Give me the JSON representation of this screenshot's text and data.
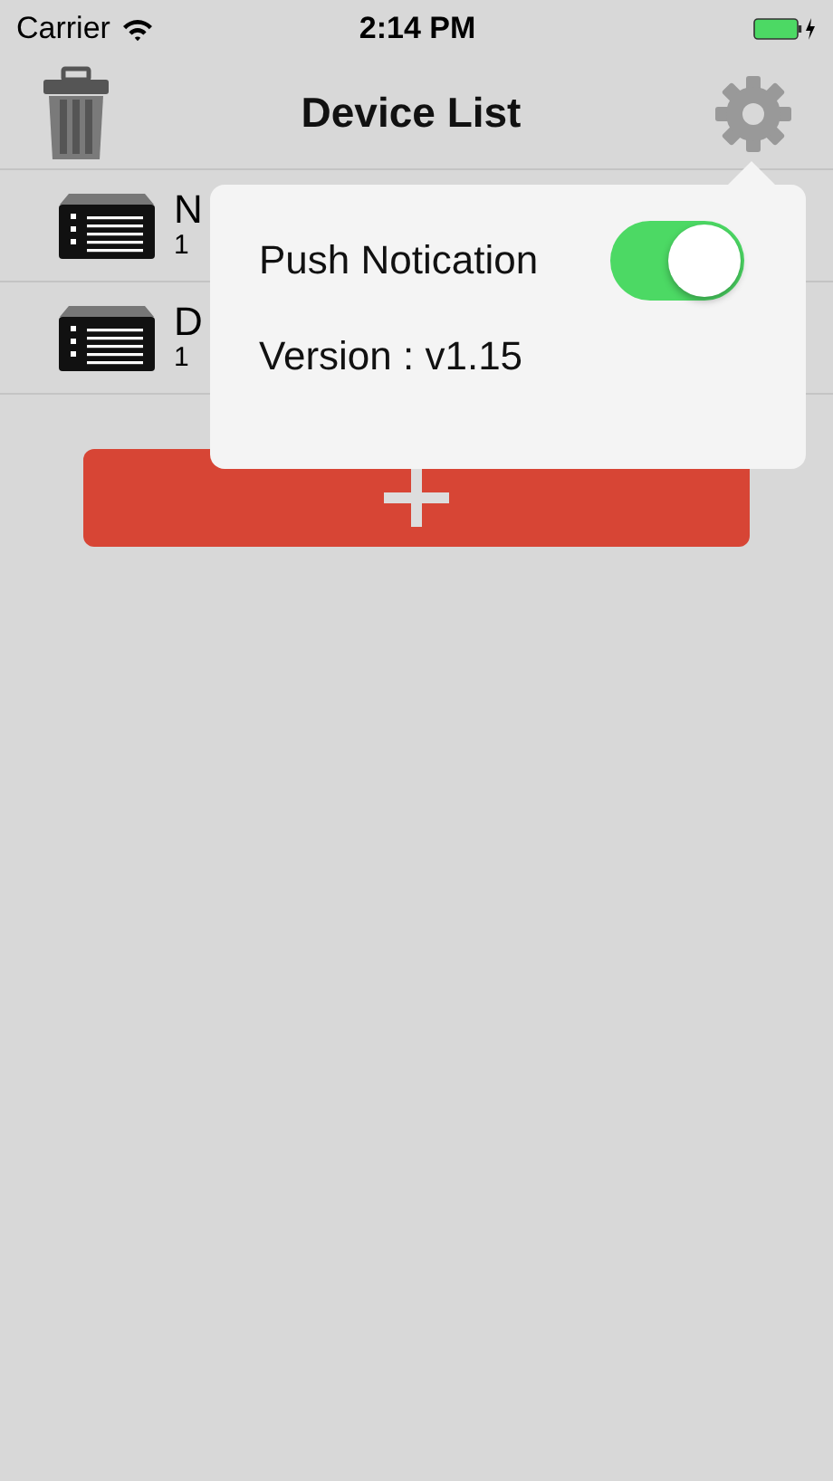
{
  "status_bar": {
    "carrier": "Carrier",
    "time": "2:14 PM"
  },
  "nav": {
    "title": "Device List"
  },
  "devices": [
    {
      "name": "N",
      "detail": "1"
    },
    {
      "name": "D",
      "detail": "1"
    }
  ],
  "popover": {
    "push_label": "Push Notication",
    "push_on": true,
    "version": "Version : v1.15"
  }
}
